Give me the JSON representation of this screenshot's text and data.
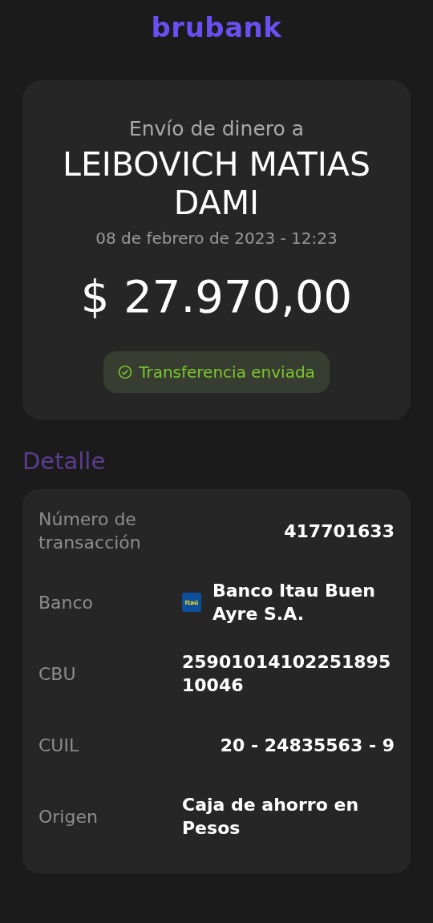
{
  "header": {
    "logo": "brubank"
  },
  "summary": {
    "subtitle": "Envío de dinero a",
    "recipient": "LEIBOVICH MATIAS DAMI",
    "date": "08 de febrero de 2023 - 12:23",
    "amount": "$ 27.970,00",
    "status": {
      "label": "Transferencia enviada",
      "kind": "success"
    }
  },
  "details": {
    "title": "Detalle",
    "rows": [
      {
        "label": "Número de transacción",
        "value": "417701633",
        "kind": "plain"
      },
      {
        "label": "Banco",
        "value": "Banco Itau Buen Ayre S.A.",
        "kind": "bank",
        "logo_text": "Itaú"
      },
      {
        "label": "CBU",
        "value": "2590101410225189510046",
        "kind": "plain"
      },
      {
        "label": "CUIL",
        "value": "20 - 24835563 - 9",
        "kind": "plain"
      },
      {
        "label": "Origen",
        "value": "Caja de ahorro en Pesos",
        "kind": "plain"
      }
    ]
  }
}
